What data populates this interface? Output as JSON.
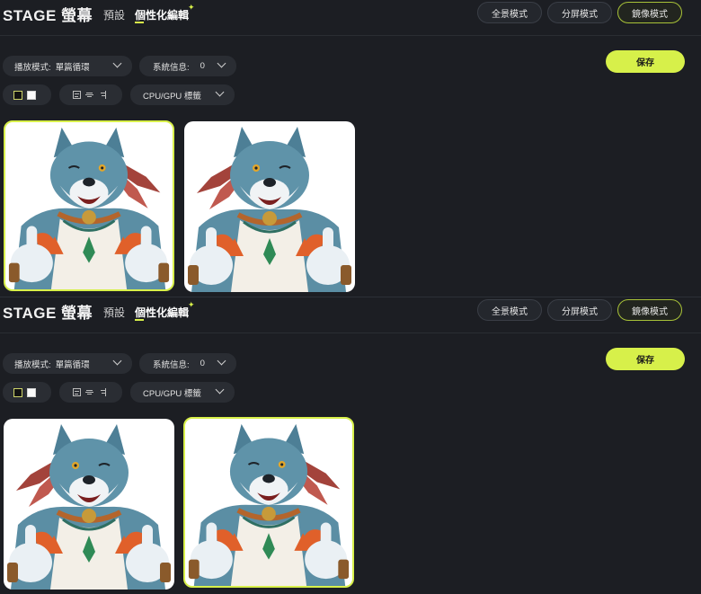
{
  "header": {
    "brand": "STAGE 螢幕",
    "nav_preset": "預設",
    "nav_edit": "個性化編輯",
    "sparkle": "✦"
  },
  "modes": {
    "panorama": "全景模式",
    "split": "分屏模式",
    "mirror": "鏡像模式",
    "active": "mirror"
  },
  "toolbar": {
    "save_label": "保存",
    "play_mode_label": "播放模式:",
    "play_mode_value": "單篇循環",
    "sys_info_label": "系統信息:",
    "sys_info_value": "0",
    "gpu_label": "CPU/GPU 標籤"
  },
  "colors": {
    "accent": "#d8f04a",
    "background": "#1c1e23",
    "pill": "#2a2d33"
  },
  "icons": [
    "chevron-down-icon",
    "color-swatch-black",
    "color-swatch-white",
    "align-left-icon",
    "align-center-icon",
    "align-right-icon",
    "sparkle-icon"
  ],
  "panels": [
    {
      "selected_card": 1
    },
    {
      "selected_card": 2
    }
  ]
}
